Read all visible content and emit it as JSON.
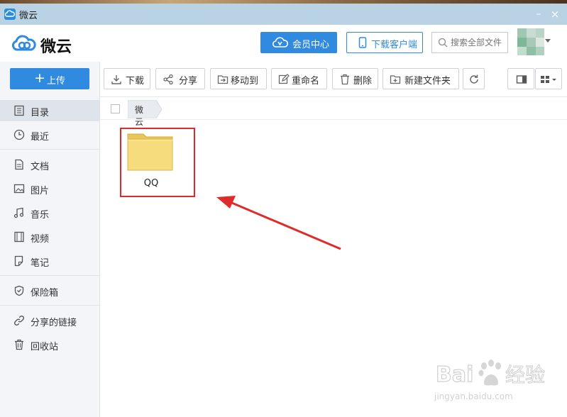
{
  "window": {
    "title": "微云",
    "minimize_glyph": "–",
    "close_glyph": "×"
  },
  "header": {
    "logo_text": "微云",
    "vip_center_label": "会员中心",
    "download_client_label": "下载客户端",
    "search_placeholder": "搜索全部文件"
  },
  "sidebar": {
    "upload_label": "上传",
    "upload_plus": "+",
    "items": [
      {
        "label": "目录",
        "icon": "list-icon",
        "active": true
      },
      {
        "label": "最近",
        "icon": "clock-icon"
      },
      {
        "label": "文档",
        "icon": "document-icon"
      },
      {
        "label": "图片",
        "icon": "image-icon"
      },
      {
        "label": "音乐",
        "icon": "music-icon"
      },
      {
        "label": "视频",
        "icon": "film-icon"
      },
      {
        "label": "笔记",
        "icon": "note-icon"
      },
      {
        "label": "保险箱",
        "icon": "shield-icon"
      },
      {
        "label": "分享的链接",
        "icon": "link-icon"
      },
      {
        "label": "回收站",
        "icon": "trash-icon"
      }
    ]
  },
  "toolbar": {
    "download_label": "下载",
    "share_label": "分享",
    "move_label": "移动到",
    "rename_label": "重命名",
    "delete_label": "删除",
    "new_folder_label": "新建文件夹"
  },
  "content": {
    "breadcrumb": "微云",
    "files": [
      {
        "name": "QQ",
        "type": "folder"
      }
    ]
  },
  "watermark": {
    "brand": "Bai du 经验",
    "domain": "jingyan.baidu.com"
  },
  "colors": {
    "accent": "#2f8ae0",
    "titlebar": "#b9d3e4",
    "highlight": "#e02b2b",
    "folder": "#f7dc7d"
  }
}
